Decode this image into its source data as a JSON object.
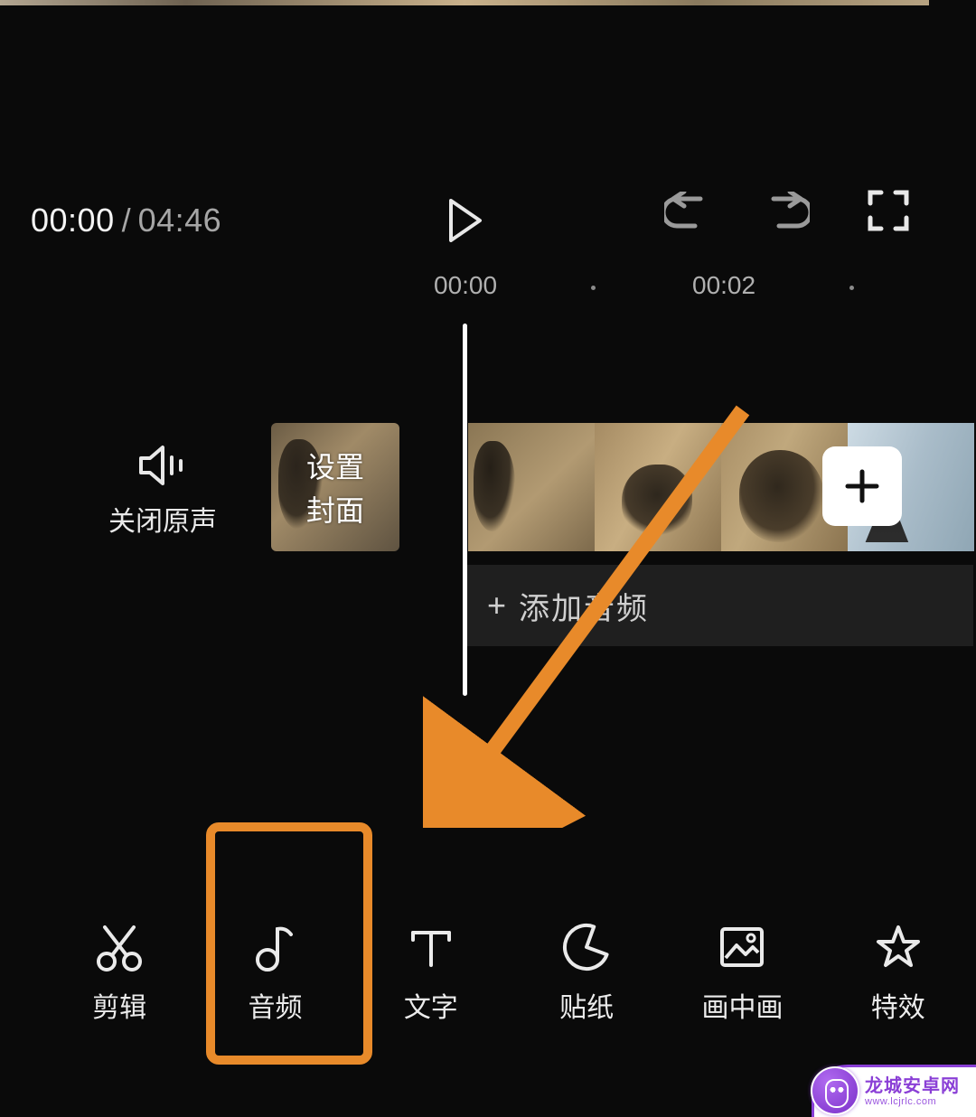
{
  "playback": {
    "current": "00:00",
    "separator": "/",
    "total": "04:46"
  },
  "ruler": {
    "marks": [
      "00:00",
      "00:02"
    ]
  },
  "mute_original": {
    "label": "关闭原声"
  },
  "cover": {
    "line1": "设置",
    "line2": "封面"
  },
  "add_audio": {
    "plus": "+",
    "label": "添加音频"
  },
  "toolbar": [
    {
      "key": "edit",
      "label": "剪辑"
    },
    {
      "key": "audio",
      "label": "音频"
    },
    {
      "key": "text",
      "label": "文字"
    },
    {
      "key": "sticker",
      "label": "贴纸"
    },
    {
      "key": "pip",
      "label": "画中画"
    },
    {
      "key": "effects",
      "label": "特效"
    }
  ],
  "annotation": {
    "highlight_color": "#e88a2a"
  },
  "watermark": {
    "line1": "龙城安卓网",
    "line2": "www.lcjrlc.com"
  }
}
